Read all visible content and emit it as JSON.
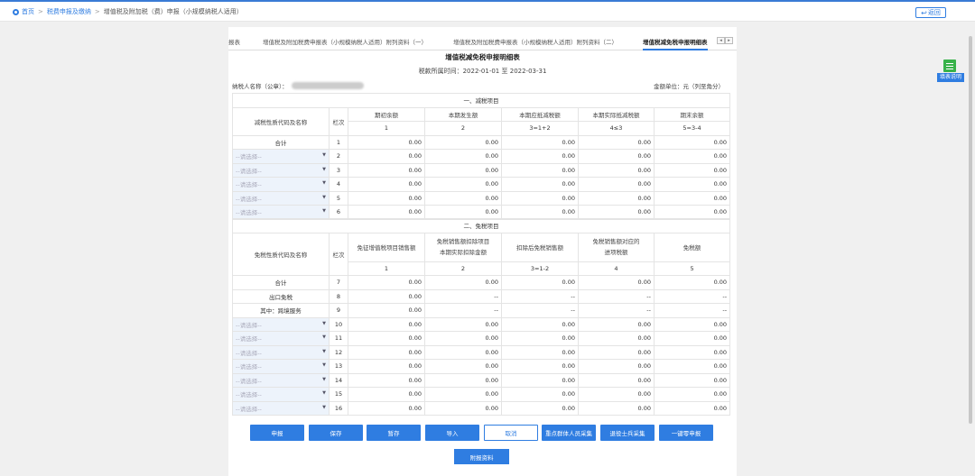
{
  "breadcrumb": {
    "home": "首页",
    "level2": "税费申报及缴纳",
    "current": "增值税及附加税（费）申报（小规模纳税人适用）"
  },
  "back_button": "返回",
  "side_help": "填表说明",
  "tabs": [
    {
      "label": "报表"
    },
    {
      "label": "增值税及附加税费申报表（小规模纳税人适用）附列资料（一）"
    },
    {
      "label": "增值税及附加税费申报表（小规模纳税人适用）附列资料（二）"
    },
    {
      "label": "增值税减免税申报明细表"
    }
  ],
  "tab_arrows": {
    "left": "◂",
    "right": "▸"
  },
  "form": {
    "title": "增值税减免税申报明细表",
    "period_label": "税款所属时间：",
    "period_start": "2022-01-01",
    "period_to": "至",
    "period_end": "2022-03-31",
    "taxpayer_label": "纳税人名称（公章）：",
    "unit_label": "金额单位：元（列至角分）"
  },
  "section1": {
    "title": "一、减税项目",
    "code_header": "减税性质代码及名称",
    "row_header": "栏次",
    "columns": [
      "期初余额",
      "本期发生额",
      "本期应抵减税额",
      "本期实际抵减税额",
      "期末余额"
    ],
    "column_nums": [
      "1",
      "2",
      "3=1+2",
      "4≤3",
      "5=3-4"
    ],
    "rows": [
      {
        "name": "合计",
        "no": "1",
        "vals": [
          "0.00",
          "0.00",
          "0.00",
          "0.00",
          "0.00"
        ]
      },
      {
        "name": "--请选择--",
        "no": "2",
        "vals": [
          "0.00",
          "0.00",
          "0.00",
          "0.00",
          "0.00"
        ]
      },
      {
        "name": "--请选择--",
        "no": "3",
        "vals": [
          "0.00",
          "0.00",
          "0.00",
          "0.00",
          "0.00"
        ]
      },
      {
        "name": "--请选择--",
        "no": "4",
        "vals": [
          "0.00",
          "0.00",
          "0.00",
          "0.00",
          "0.00"
        ]
      },
      {
        "name": "--请选择--",
        "no": "5",
        "vals": [
          "0.00",
          "0.00",
          "0.00",
          "0.00",
          "0.00"
        ]
      },
      {
        "name": "--请选择--",
        "no": "6",
        "vals": [
          "0.00",
          "0.00",
          "0.00",
          "0.00",
          "0.00"
        ]
      }
    ]
  },
  "section2": {
    "title": "二、免税项目",
    "code_header": "免税性质代码及名称",
    "row_header": "栏次",
    "columns": [
      "免征增值税项目销售额",
      "免税销售额扣除项目本期实际扣除金额",
      "扣除后免税销售额",
      "免税销售额对应的进项税额",
      "免税额"
    ],
    "col2_line1": "免税销售额扣除项目",
    "col2_line2": "本期实际扣除金额",
    "col4_line1": "免税销售额对应的",
    "col4_line2": "进项税额",
    "column_nums": [
      "1",
      "2",
      "3=1-2",
      "4",
      "5"
    ],
    "rows": [
      {
        "name": "合计",
        "no": "7",
        "vals": [
          "0.00",
          "0.00",
          "0.00",
          "0.00",
          "0.00"
        ]
      },
      {
        "name": "出口免税",
        "no": "8",
        "vals": [
          "0.00",
          "--",
          "--",
          "--",
          "--"
        ]
      },
      {
        "name": "其中：跨境服务",
        "no": "9",
        "vals": [
          "0.00",
          "--",
          "--",
          "--",
          "--"
        ]
      },
      {
        "name": "--请选择--",
        "no": "10",
        "vals": [
          "0.00",
          "0.00",
          "0.00",
          "0.00",
          "0.00"
        ]
      },
      {
        "name": "--请选择--",
        "no": "11",
        "vals": [
          "0.00",
          "0.00",
          "0.00",
          "0.00",
          "0.00"
        ]
      },
      {
        "name": "--请选择--",
        "no": "12",
        "vals": [
          "0.00",
          "0.00",
          "0.00",
          "0.00",
          "0.00"
        ]
      },
      {
        "name": "--请选择--",
        "no": "13",
        "vals": [
          "0.00",
          "0.00",
          "0.00",
          "0.00",
          "0.00"
        ]
      },
      {
        "name": "--请选择--",
        "no": "14",
        "vals": [
          "0.00",
          "0.00",
          "0.00",
          "0.00",
          "0.00"
        ]
      },
      {
        "name": "--请选择--",
        "no": "15",
        "vals": [
          "0.00",
          "0.00",
          "0.00",
          "0.00",
          "0.00"
        ]
      },
      {
        "name": "--请选择--",
        "no": "16",
        "vals": [
          "0.00",
          "0.00",
          "0.00",
          "0.00",
          "0.00"
        ]
      }
    ]
  },
  "buttons": {
    "declare": "申报",
    "save": "保存",
    "temp_save": "暂存",
    "import": "导入",
    "cancel": "取消",
    "key_group": "重点群体人员采集",
    "veteran": "退役士兵采集",
    "one_click": "一键零申报",
    "attachment": "附报资料"
  },
  "colors": {
    "accent": "#2f7de1",
    "select_bg": "#edf3fb",
    "help_icon": "#38b24a"
  }
}
